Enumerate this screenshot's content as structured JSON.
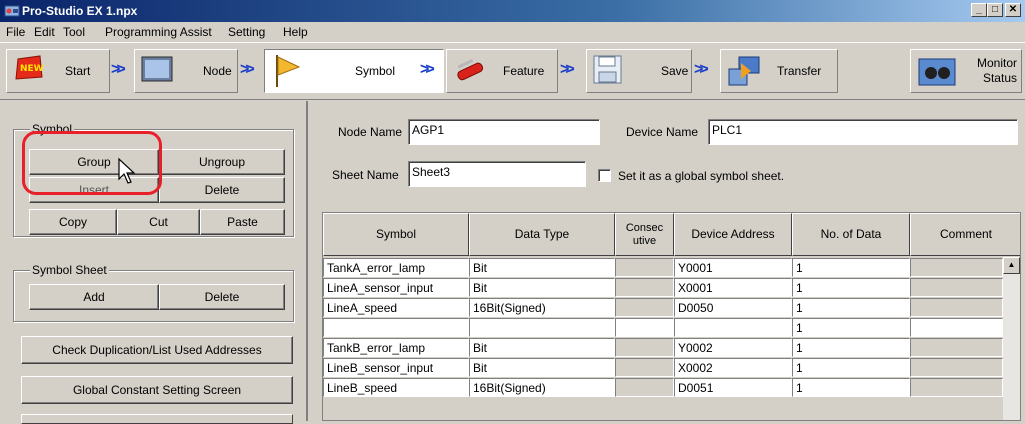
{
  "window": {
    "title": "Pro-Studio EX    1.npx",
    "buttons": [
      "_",
      "□",
      "✕"
    ]
  },
  "menu": [
    "File",
    "Edit",
    "Tool",
    "Programming Assist",
    "Setting",
    "Help"
  ],
  "toolbar": {
    "steps": [
      {
        "label": "Start",
        "icon": "new-badge-icon"
      },
      {
        "label": "Node",
        "icon": "monitor-icon"
      },
      {
        "label": "Symbol",
        "icon": "flag-icon",
        "active": true
      },
      {
        "label": "Feature",
        "icon": "multitool-icon"
      },
      {
        "label": "Save",
        "icon": "floppy-icon"
      },
      {
        "label": "Transfer",
        "icon": "transfer-icon"
      }
    ],
    "arrow": ">>",
    "monitor": {
      "line1": "Monitor",
      "line2": "Status",
      "icon": "binoculars-icon"
    }
  },
  "symbol_group": {
    "title": "Symbol",
    "group": "Group",
    "ungroup": "Ungroup",
    "insert": "Insert",
    "delete": "Delete",
    "copy": "Copy",
    "cut": "Cut",
    "paste": "Paste"
  },
  "sheet_group": {
    "title": "Symbol Sheet",
    "add": "Add",
    "delete": "Delete"
  },
  "check_dup_button": "Check Duplication/List Used Addresses",
  "global_const_button": "Global Constant Setting Screen",
  "form": {
    "node_name_label": "Node Name",
    "node_name_value": "AGP1",
    "device_name_label": "Device Name",
    "device_name_value": "PLC1",
    "sheet_name_label": "Sheet Name",
    "sheet_name_value": "Sheet3",
    "global_checkbox_label": "Set it as a global symbol sheet."
  },
  "table": {
    "headers": [
      "Symbol",
      "Data Type",
      "Consec utive",
      "Device Address",
      "No. of Data",
      "Comment"
    ],
    "rows": [
      [
        "TankA_error_lamp",
        "Bit",
        "",
        "Y0001",
        "1",
        ""
      ],
      [
        "LineA_sensor_input",
        "Bit",
        "",
        "X0001",
        "1",
        ""
      ],
      [
        "LineA_speed",
        "16Bit(Signed)",
        "",
        "D0050",
        "1",
        ""
      ],
      [
        "",
        "",
        "",
        "",
        "1",
        ""
      ],
      [
        "TankB_error_lamp",
        "Bit",
        "",
        "Y0002",
        "1",
        ""
      ],
      [
        "LineB_sensor_input",
        "Bit",
        "",
        "X0002",
        "1",
        ""
      ],
      [
        "LineB_speed",
        "16Bit(Signed)",
        "",
        "D0051",
        "1",
        ""
      ]
    ]
  },
  "colors": {
    "title_bar": "#0a246a",
    "face": "#d4d0c8",
    "highlight_ring": "#e8202a",
    "arrow": "#1a3ec8"
  }
}
